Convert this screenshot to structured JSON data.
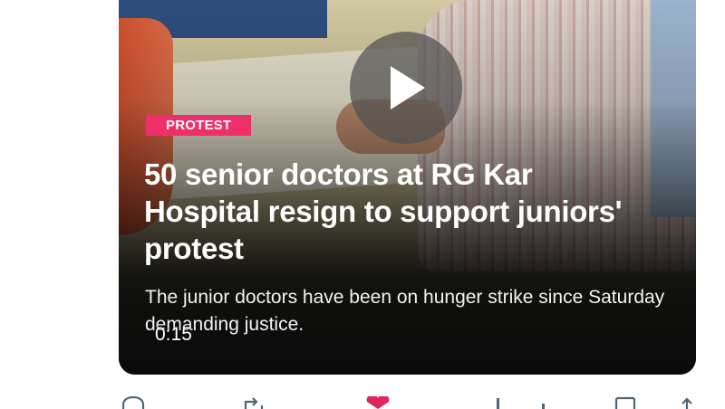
{
  "video": {
    "category_tag": "PROTEST",
    "headline": "50 senior doctors at RG Kar Hospital resign to support juniors' protest",
    "subtext": "The junior doctors have been on hunger strike since Saturday demanding justice.",
    "elapsed_time": "0:15"
  },
  "actions": [
    {
      "name": "reply-icon"
    },
    {
      "name": "repost-icon"
    },
    {
      "name": "like-icon",
      "color": "#e0245e"
    },
    {
      "name": "views-icon"
    },
    {
      "name": "bookmark-icon"
    },
    {
      "name": "share-icon"
    }
  ],
  "colors": {
    "tag_background": "#ef2f6a",
    "like_active": "#e0245e"
  }
}
